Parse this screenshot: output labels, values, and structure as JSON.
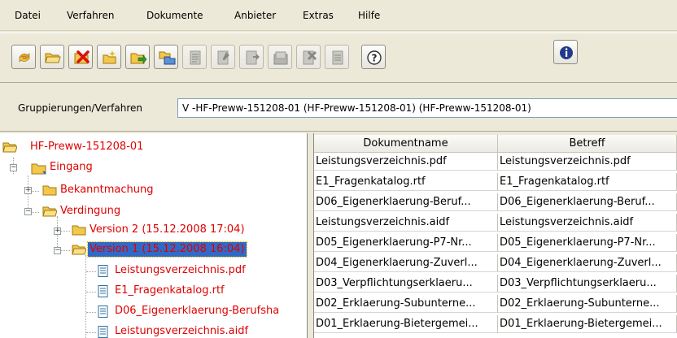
{
  "menu": [
    "Datei",
    "Verfahren",
    "Dokumente",
    "Anbieter",
    "Extras",
    "Hilfe"
  ],
  "toolbar": {
    "buttons": [
      {
        "name": "refresh-icon",
        "enabled": true
      },
      {
        "name": "open-folder-icon",
        "enabled": true
      },
      {
        "name": "delete-icon",
        "enabled": true
      },
      {
        "name": "new-folder-icon",
        "enabled": true
      },
      {
        "name": "import-icon",
        "enabled": true
      },
      {
        "name": "structure-icon",
        "enabled": true
      },
      {
        "name": "document-icon",
        "enabled": false
      },
      {
        "name": "document-edit-icon",
        "enabled": false
      },
      {
        "name": "document-forward-icon",
        "enabled": false
      },
      {
        "name": "document-stack-icon",
        "enabled": false
      },
      {
        "name": "document-delete-icon",
        "enabled": false
      },
      {
        "name": "document-list-icon",
        "enabled": false
      },
      {
        "name": "help-icon",
        "enabled": true
      },
      {
        "name": "info-icon",
        "enabled": true
      }
    ]
  },
  "group": {
    "label": "Gruppierungen/Verfahren",
    "value": "V -HF-Preww-151208-01 (HF-Preww-151208-01) (HF-Preww-151208-01)"
  },
  "tree": {
    "root": "HF-Preww-151208-01",
    "eingang": "Eingang",
    "bekanntmachung": "Bekanntmachung",
    "verdingung": "Verdingung",
    "version2": "Version 2 (15.12.2008 17:04)",
    "version1": "Version 1 (15.12.2008 16:04)",
    "files": [
      "Leistungsverzeichnis.pdf",
      "E1_Fragenkatalog.rtf",
      "D06_Eigenerklaerung-Berufsha",
      "Leistungsverzeichnis.aidf"
    ]
  },
  "table": {
    "columns": [
      "Dokumentname",
      "Betreff"
    ],
    "rows": [
      [
        "Leistungsverzeichnis.pdf",
        "Leistungsverzeichnis.pdf"
      ],
      [
        "E1_Fragenkatalog.rtf",
        "E1_Fragenkatalog.rtf"
      ],
      [
        "D06_Eigenerklaerung-Beruf...",
        "D06_Eigenerklaerung-Beruf..."
      ],
      [
        "Leistungsverzeichnis.aidf",
        "Leistungsverzeichnis.aidf"
      ],
      [
        "D05_Eigenerklaerung-P7-Nr...",
        "D05_Eigenerklaerung-P7-Nr..."
      ],
      [
        "D04_Eigenerklaerung-Zuverl...",
        "D04_Eigenerklaerung-Zuverl..."
      ],
      [
        "D03_Verpflichtungserklaeru...",
        "D03_Verpflichtungserklaeru..."
      ],
      [
        "D02_Erklaerung-Subunterne...",
        "D02_Erklaerung-Subunterne..."
      ],
      [
        "D01_Erklaerung-Bietergemei...",
        "D01_Erklaerung-Bietergemei..."
      ]
    ]
  },
  "colors": {
    "tree_text": "#e00000",
    "selection": "#3169c6"
  }
}
